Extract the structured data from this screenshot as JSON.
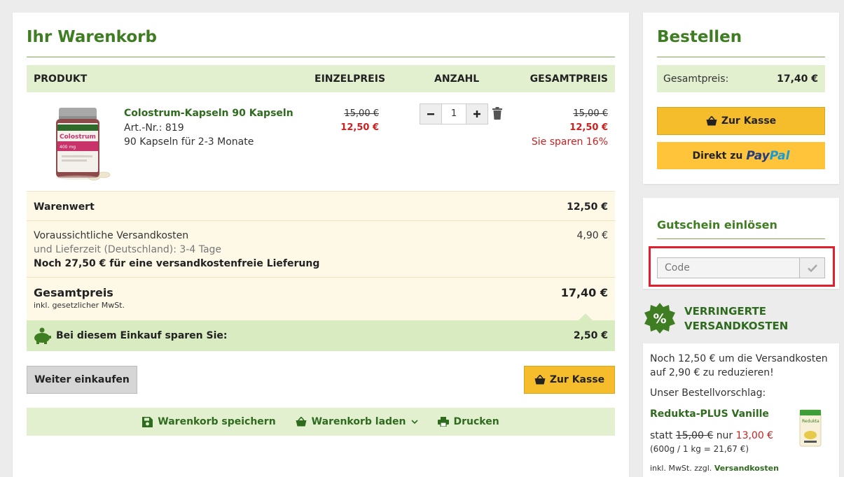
{
  "cart": {
    "title": "Ihr Warenkorb",
    "columns": {
      "product": "PRODUKT",
      "single_price": "EINZELPREIS",
      "quantity": "ANZAHL",
      "total_price": "GESAMTPREIS"
    },
    "item": {
      "name": "Colostrum-Kapseln 90 Kapseln",
      "sku": "Art.-Nr.: 819",
      "description": "90 Kapseln für 2-3 Monate",
      "single_old": "15,00 €",
      "single_new": "12,50 €",
      "quantity": "1",
      "total_old": "15,00 €",
      "total_new": "12,50 €",
      "saving_note": "Sie sparen 16%",
      "image_label": "Colostrum",
      "image_sub": "400 mg"
    },
    "summary": {
      "goods_label": "Warenwert",
      "goods_value": "12,50 €",
      "shipping_label": "Voraussichtliche Versandkosten",
      "shipping_time": "und Lieferzeit (Deutschland): 3-4 Tage",
      "free_shipping_note": "Noch 27,50 € für eine versandkostenfreie Lieferung",
      "shipping_value": "4,90 €",
      "total_label": "Gesamtpreis",
      "total_note": "inkl. gesetzlicher MwSt.",
      "total_value": "17,40 €"
    },
    "savings": {
      "label": "Bei diesem Einkauf sparen Sie:",
      "value": "2,50 €"
    },
    "buttons": {
      "continue": "Weiter einkaufen",
      "checkout": "Zur Kasse"
    },
    "actions": {
      "save": "Warenkorb speichern",
      "load": "Warenkorb laden",
      "print": "Drucken"
    }
  },
  "order": {
    "title": "Bestellen",
    "total_label": "Gesamtpreis:",
    "total_value": "17,40 €",
    "checkout": "Zur Kasse",
    "paypal_prefix": "Direkt zu",
    "paypal_a": "Pay",
    "paypal_b": "Pal"
  },
  "voucher": {
    "title": "Gutschein einlösen",
    "placeholder": "Code"
  },
  "shipping_promo": {
    "badge": "%",
    "title_line1": "VERRINGERTE",
    "title_line2": "VERSANDKOSTEN",
    "text": "Noch 12,50 € um die Versandkosten auf 2,90 € zu reduzieren!",
    "suggestion": "Unser Bestellvorschlag:",
    "product_name": "Redukta-PLUS Vanille",
    "price_prefix": "statt",
    "price_old": "15,00 €",
    "price_mid": "nur",
    "price_new": "13,00 €",
    "unit_price": "(600g / 1 kg = 21,67 €)",
    "tax_note": "inkl. MwSt. zzgl.",
    "tax_link": "Versandkosten",
    "image_label": "Redukta"
  },
  "colors": {
    "green": "#3f7d23",
    "light_green": "#e2f0cf",
    "yellow": "#f5bd2c",
    "red": "#cc1f1f",
    "cream": "#fef9e7"
  }
}
